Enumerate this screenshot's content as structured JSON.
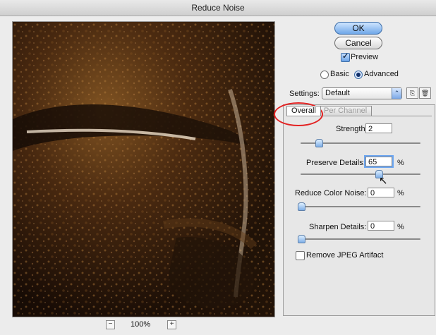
{
  "window": {
    "title": "Reduce Noise"
  },
  "preview": {
    "zoom": "100%",
    "zoom_out_icon": "−",
    "zoom_in_icon": "+"
  },
  "buttons": {
    "ok": "OK",
    "cancel": "Cancel"
  },
  "preview_toggle": {
    "label": "Preview",
    "checked": true
  },
  "mode": {
    "basic": "Basic",
    "advanced": "Advanced",
    "selected": "Advanced"
  },
  "settings": {
    "label": "Settings:",
    "value": "Default"
  },
  "tabs": [
    {
      "label": "Overall",
      "active": true
    },
    {
      "label": "Per Channel",
      "active": false
    }
  ],
  "controls": [
    {
      "label": "Strength:",
      "value": "2",
      "unit": "",
      "slider_fraction": 0.1
    },
    {
      "label": "Preserve Details:",
      "value": "65",
      "unit": "%",
      "slider_fraction": 0.65
    },
    {
      "label": "Reduce Color Noise:",
      "value": "0",
      "unit": "%",
      "slider_fraction": 0.0
    },
    {
      "label": "Sharpen Details:",
      "value": "0",
      "unit": "%",
      "slider_fraction": 0.0
    }
  ],
  "remove_jpeg": {
    "label": "Remove JPEG Artifact",
    "checked": false
  },
  "colors": {
    "accent": "#6fa7e8",
    "annotation": "#e32222"
  }
}
